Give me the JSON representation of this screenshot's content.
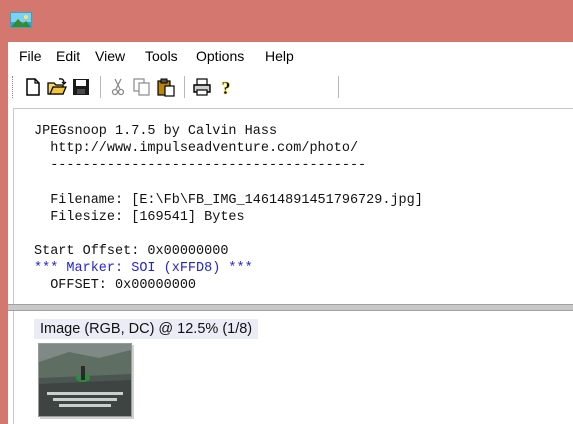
{
  "menu": [
    "File",
    "Edit",
    "View",
    "Tools",
    "Options",
    "Help"
  ],
  "toolbar": {
    "buttons": [
      "new-icon",
      "open-icon",
      "save-icon",
      "cut-icon",
      "copy-icon",
      "paste-icon",
      "print-icon",
      "help-icon"
    ]
  },
  "log": {
    "line1": "JPEGsnoop 1.7.5 by Calvin Hass",
    "line2": "  http://www.impulseadventure.com/photo/",
    "line3": "  ---------------------------------------",
    "filename": "  Filename: [E:\\Fb\\FB_IMG_14614891451796729.jpg]",
    "filesize": "  Filesize: [169541] Bytes",
    "start_offset": "Start Offset: 0x00000000",
    "marker": "*** Marker: SOI (xFFD8) ***",
    "offset": "  OFFSET: 0x00000000"
  },
  "image_panel": {
    "caption": "Image (RGB, DC) @ 12.5% (1/8)"
  },
  "colors": {
    "titlebar": "#d4776f",
    "marker_text": "#2323d8"
  }
}
